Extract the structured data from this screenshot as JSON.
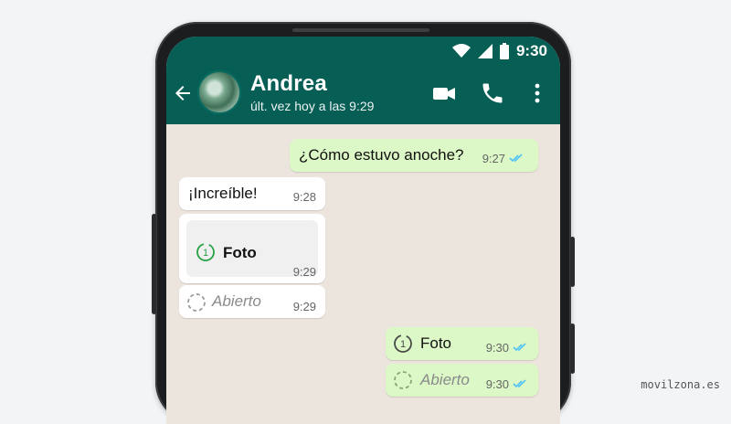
{
  "status_bar": {
    "time": "9:30"
  },
  "header": {
    "contact_name": "Andrea",
    "last_seen": "últ. vez hoy a las 9:29",
    "actions": [
      "video-call",
      "voice-call",
      "more-options"
    ]
  },
  "messages": [
    {
      "direction": "outgoing",
      "text": "¿Cómo estuvo anoche?",
      "time": "9:27",
      "read": true
    },
    {
      "direction": "incoming",
      "text": "¡Increíble!",
      "time": "9:28"
    },
    {
      "direction": "incoming",
      "type": "view-once-photo",
      "label": "Foto",
      "time": "9:29"
    },
    {
      "direction": "incoming",
      "type": "view-once-opened",
      "label": "Abierto",
      "time": "9:29"
    },
    {
      "direction": "outgoing",
      "type": "view-once-photo",
      "label": "Foto",
      "time": "9:30",
      "read": true
    },
    {
      "direction": "outgoing",
      "type": "view-once-opened",
      "label": "Abierto",
      "time": "9:30",
      "read": true
    }
  ],
  "colors": {
    "header": "#075e54",
    "chat_bg": "#ece5dd",
    "outgoing_bubble": "#dcf8c6",
    "incoming_bubble": "#ffffff",
    "read_ticks": "#4fc3f7",
    "view_once_accent": "#25a244"
  },
  "watermark": "movilzona.es"
}
